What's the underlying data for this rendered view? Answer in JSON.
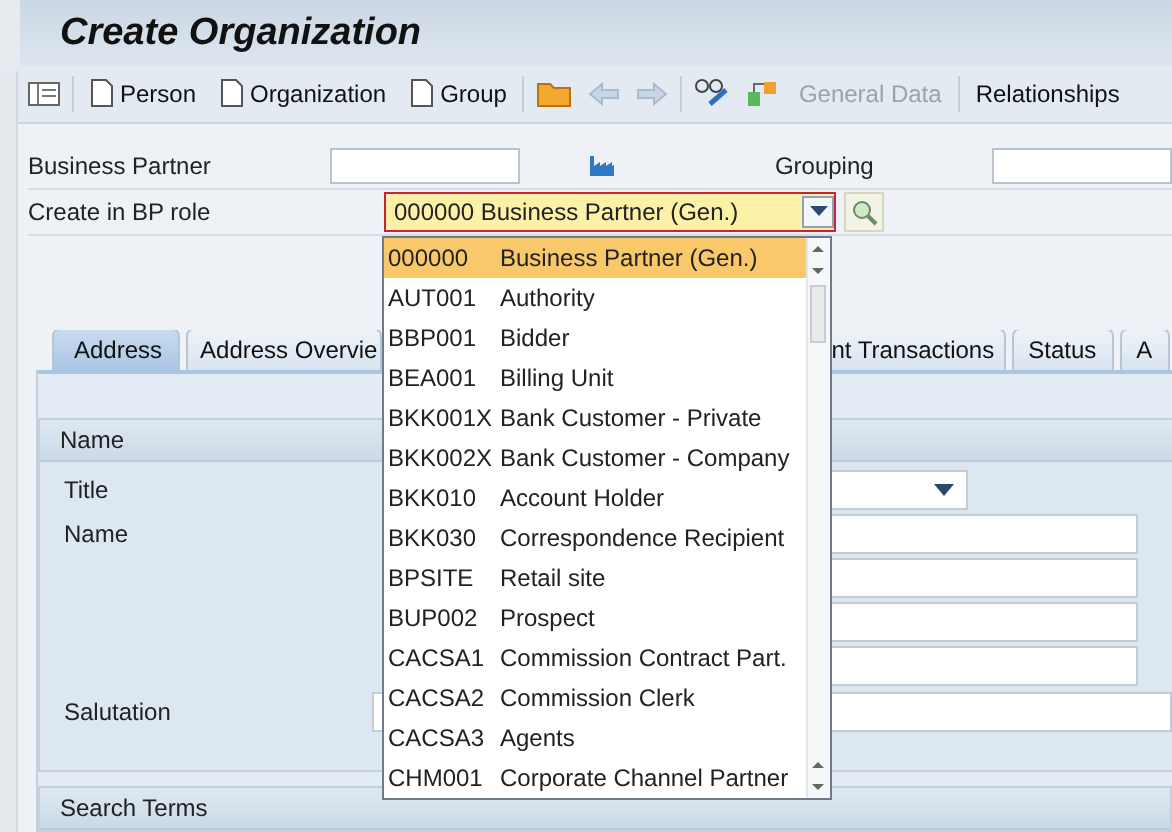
{
  "window": {
    "title": "Create Organization"
  },
  "toolbar": [
    {
      "kind": "new",
      "label": "Person",
      "disabled": false
    },
    {
      "kind": "new",
      "label": "Organization",
      "disabled": false
    },
    {
      "kind": "new",
      "label": "Group",
      "disabled": false
    },
    {
      "kind": "nav",
      "disabled": true
    },
    {
      "kind": "text",
      "label": "General Data",
      "disabled": true
    },
    {
      "kind": "text",
      "label": "Relationships",
      "disabled": false
    }
  ],
  "business_partner": {
    "label": "Business Partner"
  },
  "grouping": {
    "label": "Grouping"
  },
  "bp_role": {
    "label": "Create in BP role",
    "value": "000000 Business Partner (Gen.)"
  },
  "role_dropdown": [
    {
      "code": "000000",
      "text": "Business Partner (Gen.)",
      "selected": true
    },
    {
      "code": "AUT001",
      "text": "Authority",
      "selected": false
    },
    {
      "code": "BBP001",
      "text": "Bidder",
      "selected": false
    },
    {
      "code": "BEA001",
      "text": "Billing Unit",
      "selected": false
    },
    {
      "code": "BKK001X",
      "text": "Bank Customer - Private",
      "selected": false
    },
    {
      "code": "BKK002X",
      "text": "Bank Customer - Company",
      "selected": false
    },
    {
      "code": "BKK010",
      "text": "Account Holder",
      "selected": false
    },
    {
      "code": "BKK030",
      "text": "Correspondence Recipient",
      "selected": false
    },
    {
      "code": "BPSITE",
      "text": "Retail site",
      "selected": false
    },
    {
      "code": "BUP002",
      "text": "Prospect",
      "selected": false
    },
    {
      "code": "CACSA1",
      "text": "Commission Contract Part.",
      "selected": false
    },
    {
      "code": "CACSA2",
      "text": "Commission Clerk",
      "selected": false
    },
    {
      "code": "CACSA3",
      "text": "Agents",
      "selected": false
    },
    {
      "code": "CHM001",
      "text": "Corporate Channel Partner",
      "selected": false
    }
  ],
  "tabs": [
    {
      "label": "Address",
      "selected": true
    },
    {
      "label": "Address Overvie",
      "selected": false
    },
    {
      "label": "nt Transactions",
      "selected": false
    },
    {
      "label": "Status",
      "selected": false
    },
    {
      "label": "A",
      "selected": false
    }
  ],
  "name_section": {
    "title": "Name",
    "fields": [
      {
        "kind": "select",
        "label": "Title"
      },
      {
        "kind": "text",
        "label": "Name"
      },
      {
        "kind": "text"
      },
      {
        "kind": "text"
      },
      {
        "kind": "text"
      },
      {
        "kind": "wide",
        "label": "Salutation"
      }
    ]
  },
  "search_section": {
    "title": "Search Terms"
  }
}
